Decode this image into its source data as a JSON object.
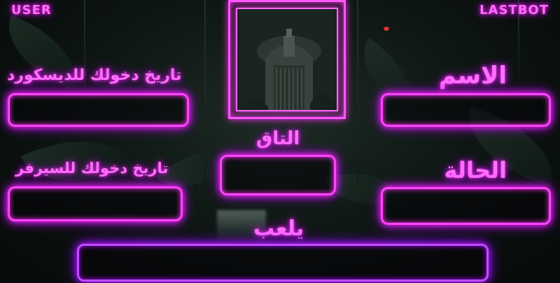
{
  "header": {
    "left_label": "USER",
    "right_label": "LASTBOT"
  },
  "fields": {
    "name": {
      "label": "الاسم",
      "value": ""
    },
    "discord_join": {
      "label": "تاريخ دخولك للديسكورد",
      "value": ""
    },
    "tag": {
      "label": "التاق",
      "value": ""
    },
    "status": {
      "label": "الحالة",
      "value": ""
    },
    "server_join": {
      "label": "تاريخ دخولك للسيرفر",
      "value": ""
    },
    "playing": {
      "label": "يلعب",
      "value": ""
    }
  },
  "avatar": {
    "icon": "temple-avatar-icon"
  },
  "colors": {
    "neon_pink": "#ff44ff",
    "neon_violet": "#c04cff",
    "glow": "#ff2df0"
  }
}
